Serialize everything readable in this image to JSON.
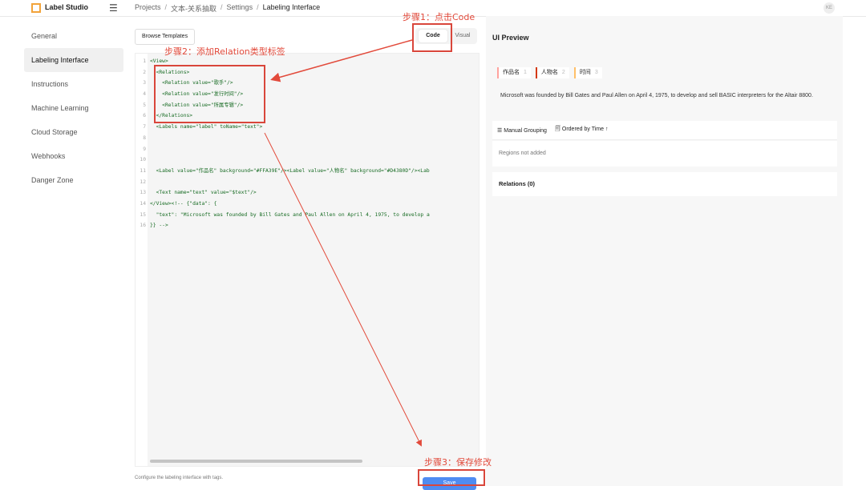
{
  "app": {
    "name": "Label Studio",
    "avatar": "KE"
  },
  "breadcrumb": [
    "Projects",
    "文本-关系抽取",
    "Settings",
    "Labeling Interface"
  ],
  "sidebar": {
    "items": [
      {
        "label": "General"
      },
      {
        "label": "Labeling Interface"
      },
      {
        "label": "Instructions"
      },
      {
        "label": "Machine Learning"
      },
      {
        "label": "Cloud Storage"
      },
      {
        "label": "Webhooks"
      },
      {
        "label": "Danger Zone"
      }
    ]
  },
  "editor": {
    "browse_label": "Browse Templates",
    "mode_code": "Code",
    "mode_visual": "Visual",
    "lines": [
      {
        "n": "1",
        "text": "<View>"
      },
      {
        "n": "2",
        "text": "  <Relations>"
      },
      {
        "n": "3",
        "text": "    <Relation value=\"歌手\"/>"
      },
      {
        "n": "4",
        "text": "    <Relation value=\"发行时间\"/>"
      },
      {
        "n": "5",
        "text": "    <Relation value=\"所属专辑\"/>"
      },
      {
        "n": "6",
        "text": "  </Relations>"
      },
      {
        "n": "7",
        "text": "  <Labels name=\"label\" toName=\"text\">"
      },
      {
        "n": "8",
        "text": ""
      },
      {
        "n": "9",
        "text": ""
      },
      {
        "n": "10",
        "text": ""
      },
      {
        "n": "11",
        "text": "  <Label value=\"作品名\" background=\"#FFA39E\"/><Label value=\"人物名\" background=\"#D4380D\"/><Lab"
      },
      {
        "n": "12",
        "text": ""
      },
      {
        "n": "13",
        "text": "  <Text name=\"text\" value=\"$text\"/>"
      },
      {
        "n": "14",
        "text": "</View><!-- {\"data\": {"
      },
      {
        "n": "15",
        "text": "  \"text\": \"Microsoft was founded by Bill Gates and Paul Allen on April 4, 1975, to develop a"
      },
      {
        "n": "16",
        "text": "}} -->"
      }
    ],
    "help_text": "Configure the labeling interface with tags.",
    "save_label": "Save"
  },
  "preview": {
    "title": "UI Preview",
    "labels": [
      {
        "name": "作品名",
        "count": "1",
        "color": "#FFA39E"
      },
      {
        "name": "人物名",
        "count": "2",
        "color": "#D4380D"
      },
      {
        "name": "时间",
        "count": "3",
        "color": "#FFC069"
      }
    ],
    "text": "Microsoft was founded by Bill Gates and Paul Allen on April 4, 1975, to develop and sell BASIC interpreters for the Altair 8800.",
    "manual_grouping": "Manual Grouping",
    "ordered_by": "Ordered by Time",
    "sort_arrow": "↑",
    "regions_empty": "Regions not added",
    "relations_label": "Relations (0)"
  },
  "annotations": {
    "step1": "步骤1：点击Code",
    "step2": "步骤2：添加Relation类型标签",
    "step3": "步骤3：保存修改",
    "color": "#e24a3b"
  }
}
